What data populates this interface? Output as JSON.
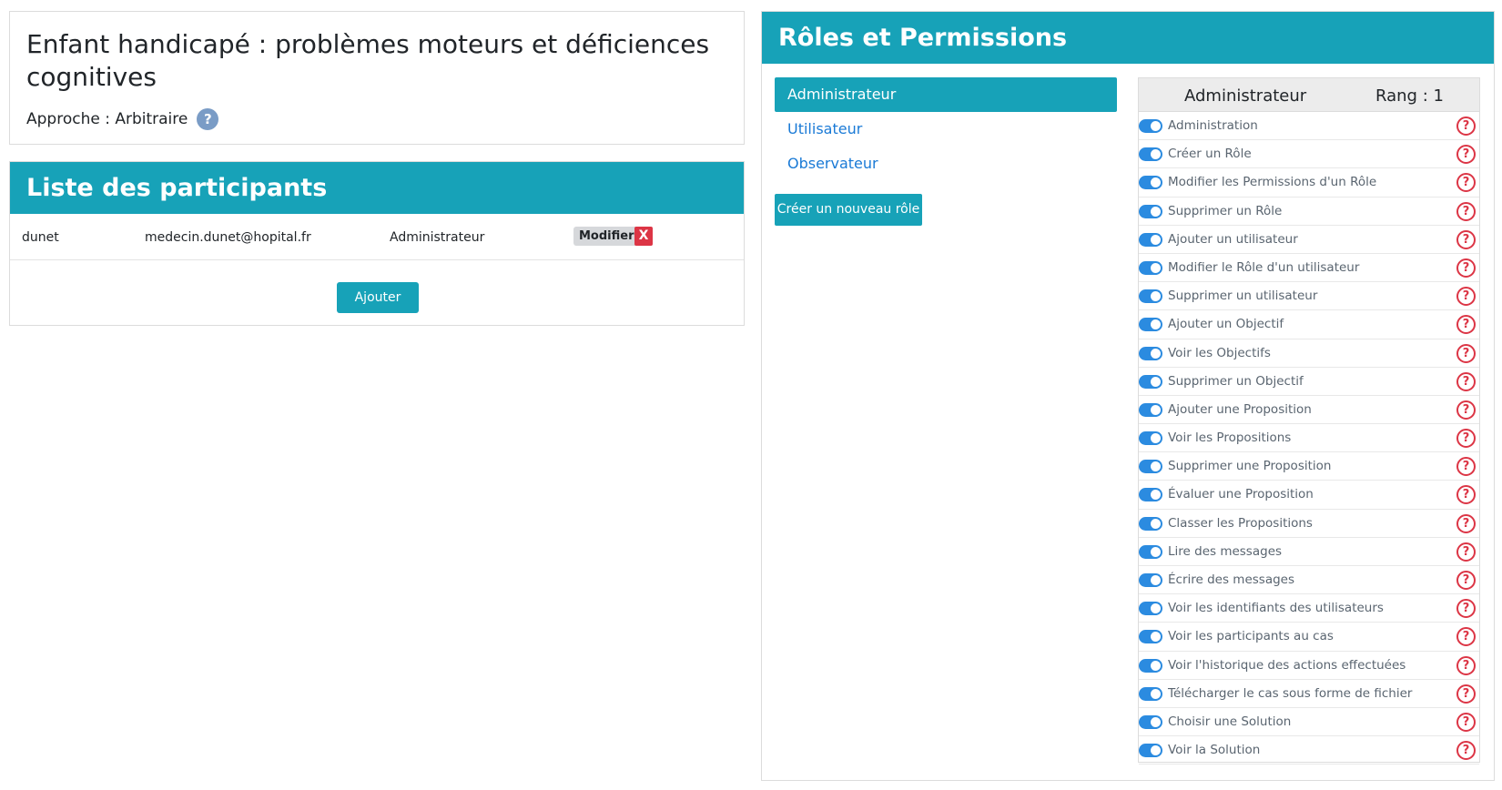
{
  "case": {
    "title": "Enfant handicapé : problèmes moteurs et déficiences cognitives",
    "approach": "Approche : Arbitraire",
    "help_glyph": "?"
  },
  "participants": {
    "heading": "Liste des participants",
    "rows": [
      {
        "name": "dunet",
        "email": "medecin.dunet@hopital.fr",
        "role": "Administrateur",
        "modify_label": "Modifier",
        "delete_label": "X"
      }
    ],
    "add_label": "Ajouter"
  },
  "roles": {
    "heading": "Rôles et Permissions",
    "items": [
      {
        "label": "Administrateur",
        "active": true
      },
      {
        "label": "Utilisateur",
        "active": false
      },
      {
        "label": "Observateur",
        "active": false
      }
    ],
    "new_role_label": "Créer un nouveau rôle"
  },
  "permissions": {
    "role_name": "Administrateur",
    "rank_label": "Rang : 1",
    "help_glyph": "?",
    "items": [
      {
        "label": "Administration",
        "enabled": true
      },
      {
        "label": "Créer un Rôle",
        "enabled": true
      },
      {
        "label": "Modifier les Permissions d'un Rôle",
        "enabled": true
      },
      {
        "label": "Supprimer un Rôle",
        "enabled": true
      },
      {
        "label": "Ajouter un utilisateur",
        "enabled": true
      },
      {
        "label": "Modifier le Rôle d'un utilisateur",
        "enabled": true
      },
      {
        "label": "Supprimer un utilisateur",
        "enabled": true
      },
      {
        "label": "Ajouter un Objectif",
        "enabled": true
      },
      {
        "label": "Voir les Objectifs",
        "enabled": true
      },
      {
        "label": "Supprimer un Objectif",
        "enabled": true
      },
      {
        "label": "Ajouter une Proposition",
        "enabled": true
      },
      {
        "label": "Voir les Propositions",
        "enabled": true
      },
      {
        "label": "Supprimer une Proposition",
        "enabled": true
      },
      {
        "label": "Évaluer une Proposition",
        "enabled": true
      },
      {
        "label": "Classer les Propositions",
        "enabled": true
      },
      {
        "label": "Lire des messages",
        "enabled": true
      },
      {
        "label": "Écrire des messages",
        "enabled": true
      },
      {
        "label": "Voir les identifiants des utilisateurs",
        "enabled": true
      },
      {
        "label": "Voir les participants au cas",
        "enabled": true
      },
      {
        "label": "Voir l'historique des actions effectuées",
        "enabled": true
      },
      {
        "label": "Télécharger le cas sous forme de fichier",
        "enabled": true
      },
      {
        "label": "Choisir une Solution",
        "enabled": true
      },
      {
        "label": "Voir la Solution",
        "enabled": true
      }
    ]
  },
  "colors": {
    "accent": "#17a2b8",
    "link": "#1a7ad6",
    "danger": "#dc3545",
    "toggle_on": "#2b8be0"
  }
}
